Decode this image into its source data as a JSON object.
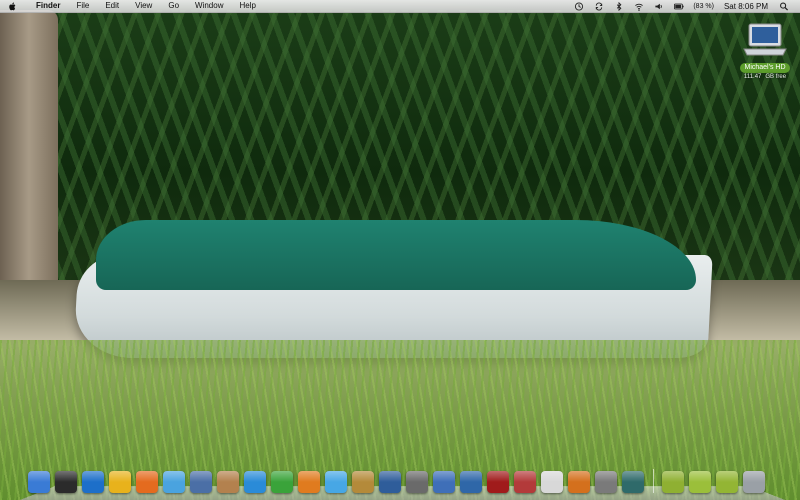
{
  "menubar": {
    "app_name": "Finder",
    "menus": [
      "File",
      "Edit",
      "View",
      "Go",
      "Window",
      "Help"
    ],
    "battery_text": "(83 %)",
    "time": "Sat 8:06 PM"
  },
  "desktop": {
    "drive_label": "Michael's HD",
    "drive_info": [
      "111.47",
      "GB free"
    ]
  },
  "dock": {
    "apps": [
      {
        "icon": "finder-icon",
        "color": "#3a7bd5"
      },
      {
        "icon": "dashboard-icon",
        "color": "#2b2b2b"
      },
      {
        "icon": "ie-globe-icon",
        "color": "#1d6fc9"
      },
      {
        "icon": "chat-icon",
        "color": "#e8b21c"
      },
      {
        "icon": "firefox-icon",
        "color": "#e46b1f"
      },
      {
        "icon": "safari-icon",
        "color": "#4aa3df"
      },
      {
        "icon": "preview-icon",
        "color": "#4b6fa6"
      },
      {
        "icon": "address-book-icon",
        "color": "#b3814e"
      },
      {
        "icon": "word-icon",
        "color": "#2a8bd8"
      },
      {
        "icon": "excel-icon",
        "color": "#3aa33a"
      },
      {
        "icon": "powerpoint-icon",
        "color": "#e07b1f"
      },
      {
        "icon": "itunes-icon",
        "color": "#47a7e5"
      },
      {
        "icon": "garageband-icon",
        "color": "#b48a3a"
      },
      {
        "icon": "imovie-icon",
        "color": "#2f5d9a"
      },
      {
        "icon": "iphoto-icon",
        "color": "#6a6a6a"
      },
      {
        "icon": "iweb-icon",
        "color": "#3f6fb8"
      },
      {
        "icon": "xcode-icon",
        "color": "#2f67a8"
      },
      {
        "icon": "spiderman-icon",
        "color": "#a01b1b"
      },
      {
        "icon": "dictionary-icon",
        "color": "#b33a3a"
      },
      {
        "icon": "ical-icon",
        "color": "#d8d8d8"
      },
      {
        "icon": "photo-booth-icon",
        "color": "#d4701d"
      },
      {
        "icon": "system-preferences-icon",
        "color": "#7a7a7a"
      },
      {
        "icon": "time-machine-icon",
        "color": "#2f6a6a"
      }
    ],
    "folders": [
      {
        "icon": "downloads-folder-icon",
        "color": "#8fb032"
      },
      {
        "icon": "documents-folder-icon",
        "color": "#9bbf3a"
      },
      {
        "icon": "applications-folder-icon",
        "color": "#93b534"
      }
    ],
    "trash": {
      "icon": "trash-icon",
      "color": "#9aa0a6"
    }
  }
}
